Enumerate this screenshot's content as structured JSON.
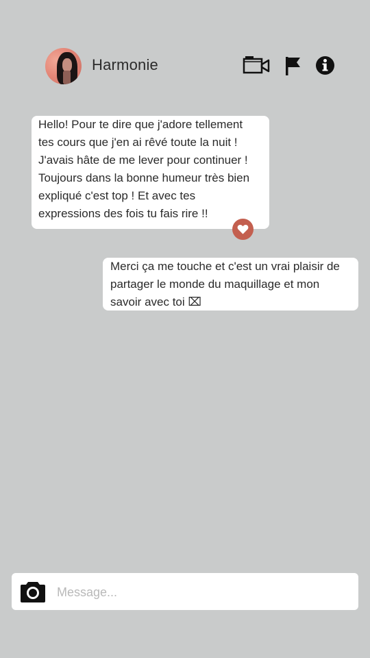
{
  "header": {
    "contact_name": "Harmonie",
    "icons": [
      "avatar",
      "video-camera-icon",
      "flag-icon",
      "info-icon"
    ]
  },
  "messages": [
    {
      "direction": "received",
      "text": "Hello! Pour te dire que j'adore tellement\ntes cours que j'en ai rêvé toute la nuit !\nJ'avais hâte de me lever pour continuer !\nToujours dans la bonne humeur très bien\nexpliqué c'est top ! Et avec tes\nexpressions des fois tu fais rire !!",
      "reaction": "heart-icon"
    },
    {
      "direction": "sent",
      "text": "Merci ça me touche et c'est un vrai plaisir de\npartager le monde du maquillage et mon\nsavoir avec toi ⌧"
    }
  ],
  "composer": {
    "placeholder": "Message...",
    "value": "",
    "icon": "camera-icon"
  },
  "colors": {
    "background": "#c9cbcb",
    "bubble": "#ffffff",
    "reaction": "#c35f4f"
  }
}
